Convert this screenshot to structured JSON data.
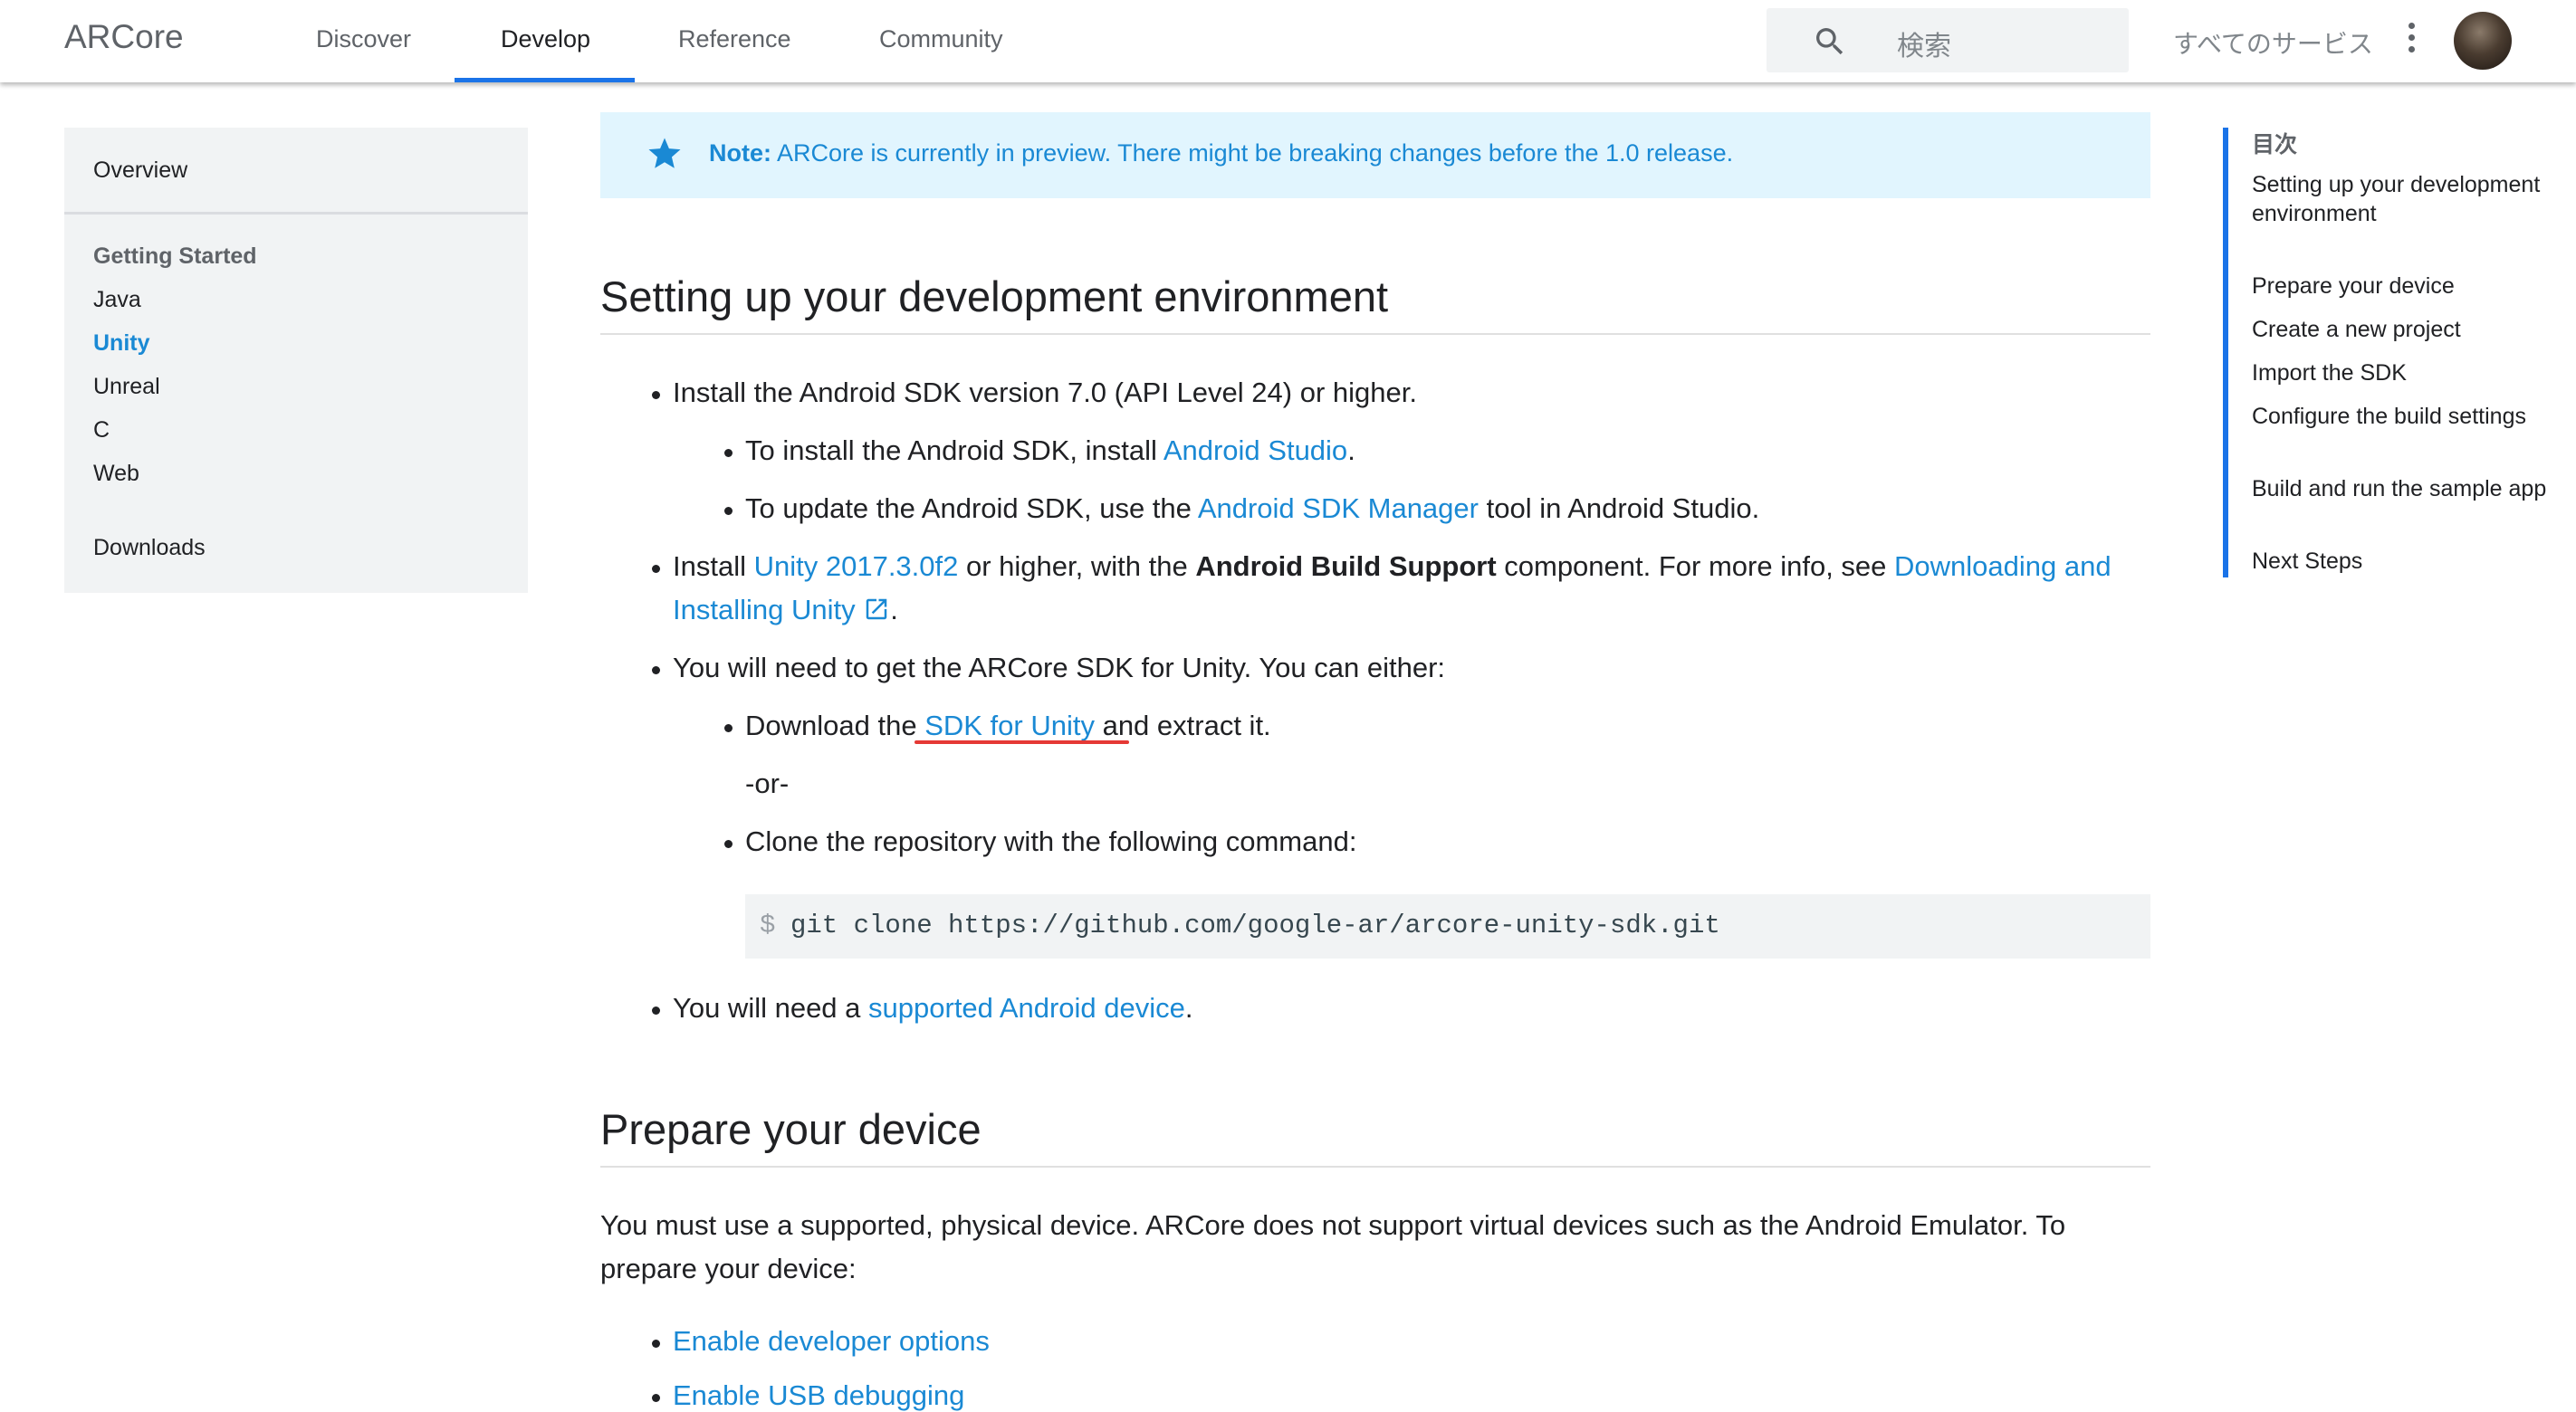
{
  "header": {
    "brand": "ARCore",
    "tabs": [
      {
        "label": "Discover"
      },
      {
        "label": "Develop"
      },
      {
        "label": "Reference"
      },
      {
        "label": "Community"
      }
    ],
    "active_tab": "Develop",
    "search_placeholder": "検索",
    "services_label": "すべてのサービス",
    "icons": [
      "search-icon",
      "more-vert-icon",
      "avatar"
    ]
  },
  "sidebar": {
    "overview": "Overview",
    "section_title": "Getting Started",
    "items": [
      {
        "label": "Java"
      },
      {
        "label": "Unity"
      },
      {
        "label": "Unreal"
      },
      {
        "label": "C"
      },
      {
        "label": "Web"
      }
    ],
    "active_item": "Unity",
    "downloads": "Downloads"
  },
  "note": {
    "label": "Note:",
    "text": "ARCore is currently in preview. There might be breaking changes before the 1.0 release."
  },
  "section1": {
    "title": "Setting up your development environment",
    "b1": "Install the Android SDK version 7.0 (API Level 24) or higher.",
    "b1a_prefix": "To install the Android SDK, install ",
    "b1a_link": "Android Studio",
    "b1a_suffix": ".",
    "b1b_prefix": "To update the Android SDK, use the ",
    "b1b_link": "Android SDK Manager",
    "b1b_suffix": " tool in Android Studio.",
    "b2_prefix": "Install ",
    "b2_link": "Unity 2017.3.0f2",
    "b2_mid": " or higher, with the ",
    "b2_bold": "Android Build Support",
    "b2_mid2": " component. For more info, see ",
    "b2_link2_line1": "Downloading and",
    "b2_link2_line2": "Installing Unity",
    "b2_suffix": ".",
    "b3": "You will need to get the ARCore SDK for Unity. You can either:",
    "b3a_prefix": "Download the",
    "b3a_link": " SDK for Unity ",
    "b3a_suffix": "and extract it.",
    "or": "-or-",
    "b3b": "Clone the repository with the following command:",
    "code_prompt": "$",
    "code": "git clone https://github.com/google-ar/arcore-unity-sdk.git",
    "b4_prefix": "You will need a ",
    "b4_link": "supported Android device",
    "b4_suffix": "."
  },
  "section2": {
    "title": "Prepare your device",
    "para": "You must use a supported, physical device. ARCore does not support virtual devices such as the Android Emulator. To prepare your device:",
    "b1": "Enable developer options",
    "b2": "Enable USB debugging"
  },
  "toc": {
    "title": "目次",
    "items": [
      {
        "label": "Setting up your development environment"
      },
      {
        "label": "Prepare your device"
      },
      {
        "label": "Create a new project"
      },
      {
        "label": "Import the SDK"
      },
      {
        "label": "Configure the build settings"
      },
      {
        "label": "Build and run the sample app"
      },
      {
        "label": "Next Steps"
      }
    ]
  },
  "colors": {
    "link": "#1a89d4",
    "accent": "#1a73e8",
    "note_bg": "#e1f5fe",
    "annotation_red": "#e53935"
  }
}
